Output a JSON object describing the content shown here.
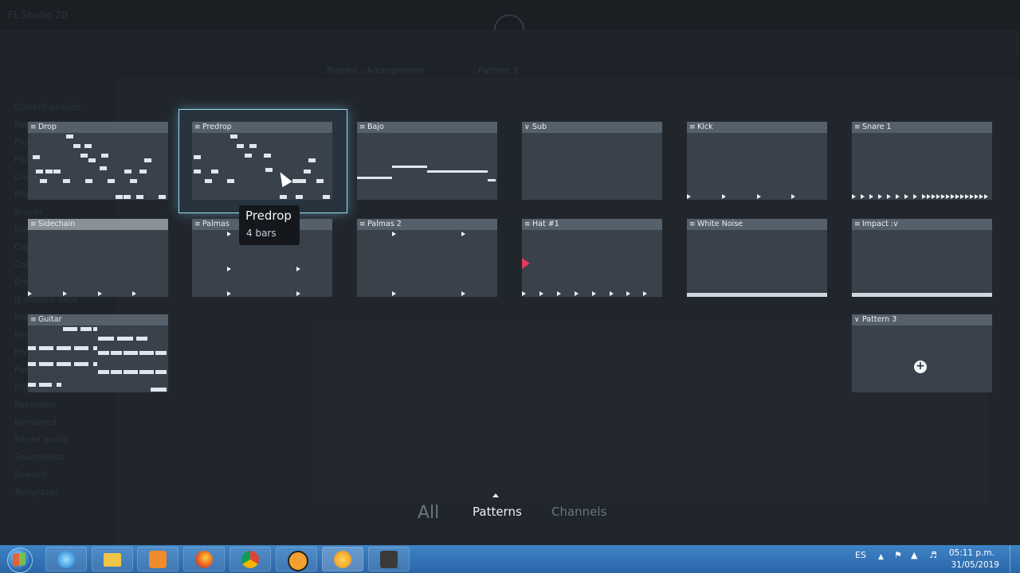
{
  "background_app": {
    "title": "FL Studio 20",
    "menu": [
      "Playlist - Arrangement",
      "Pattern 3"
    ],
    "browser_items": [
      "Current project",
      "Recent files",
      "Plugin database",
      "Plugin presets",
      "Channel presets",
      "Mixer presets",
      "Scores",
      "Backup",
      "Clipboard files",
      "Collected",
      "Envelopes",
      "IL shared data",
      "Impulses",
      "Misc",
      "My projects",
      "Packs",
      "Project bones",
      "Recorded",
      "Rendered",
      "Sliced audio",
      "Soundfonts",
      "Speech",
      "Templates"
    ]
  },
  "patterns": [
    {
      "name": "Drop",
      "icon": "pattern-icon"
    },
    {
      "name": "Predrop",
      "icon": "pattern-icon",
      "selected": true
    },
    {
      "name": "Bajo",
      "icon": "pattern-icon"
    },
    {
      "name": "Sub",
      "icon": "chevron-down-icon"
    },
    {
      "name": "Kick",
      "icon": "pattern-icon"
    },
    {
      "name": "Snare 1",
      "icon": "pattern-icon"
    },
    {
      "name": "Sidechain",
      "icon": "pattern-icon"
    },
    {
      "name": "Palmas",
      "icon": "pattern-icon"
    },
    {
      "name": "Palmas 2",
      "icon": "pattern-icon"
    },
    {
      "name": "Hat #1",
      "icon": "pattern-icon"
    },
    {
      "name": "White Noise",
      "icon": "pattern-icon"
    },
    {
      "name": "Impact :v",
      "icon": "pattern-icon"
    },
    {
      "name": "Guitar",
      "icon": "pattern-icon"
    },
    {
      "name": "Pattern 3",
      "icon": "chevron-down-icon"
    }
  ],
  "tooltip": {
    "title": "Predrop",
    "subtitle": "4 bars"
  },
  "filter_tabs": {
    "all": "All",
    "patterns": "Patterns",
    "channels": "Channels",
    "active": "Patterns"
  },
  "taskbar": {
    "apps": [
      "ie-icon",
      "explorer-icon",
      "media-player-icon",
      "firefox-icon",
      "chrome-icon",
      "vlc-icon",
      "fl-studio-icon",
      "app-icon"
    ],
    "language": "ES",
    "time": "05:11 p.m.",
    "date": "31/05/2019"
  },
  "colors": {
    "accent_selected": "#9fdcf4",
    "play_marker": "#e23a58",
    "taskbar": "#2f6fb0"
  }
}
